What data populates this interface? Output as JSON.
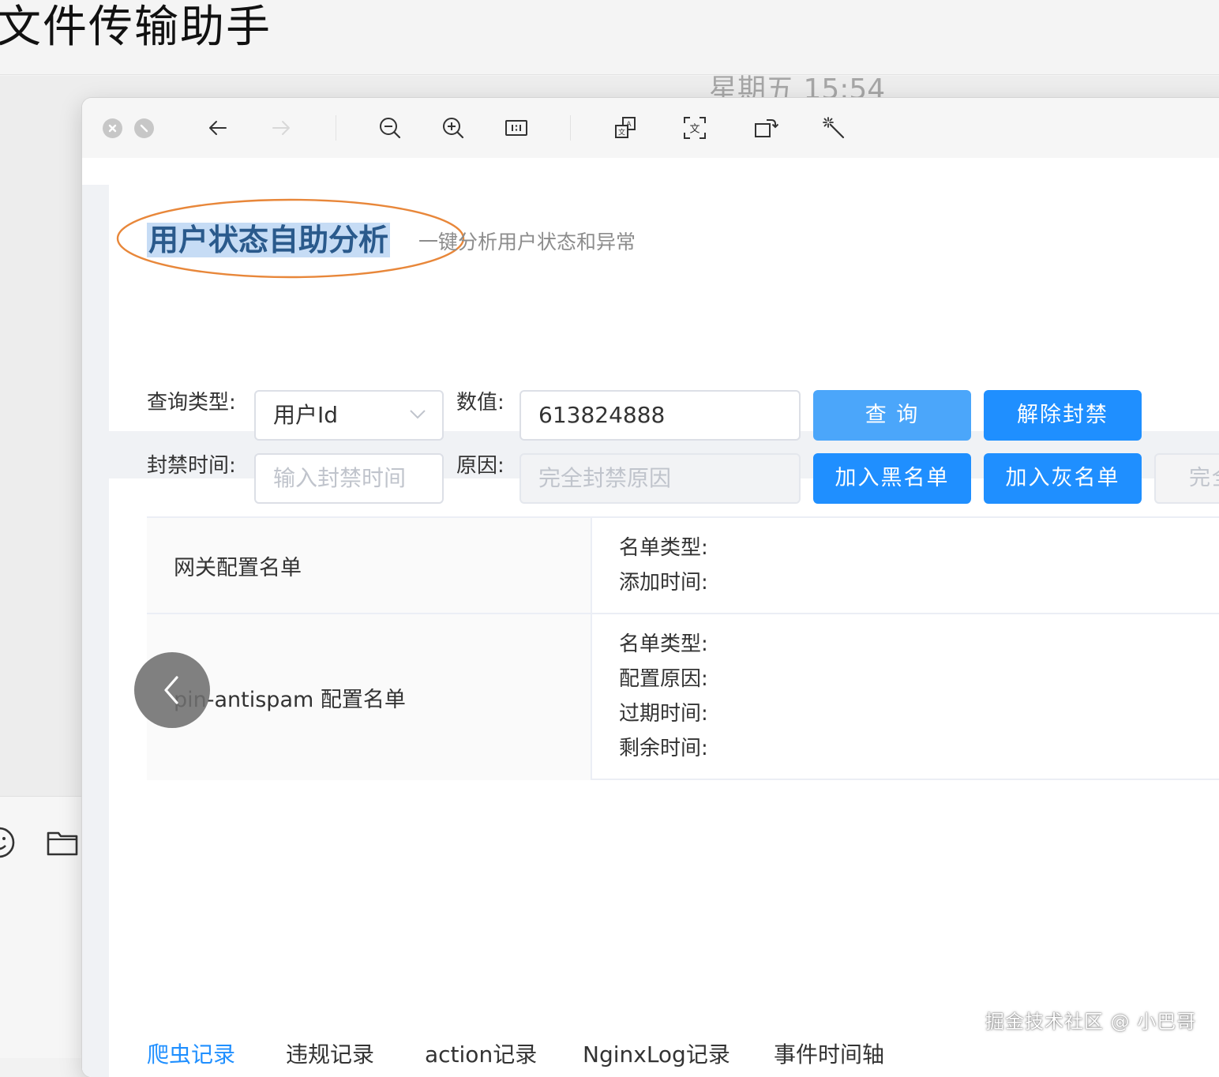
{
  "chat": {
    "title": "文件传输助手",
    "timestamp": "星期五 15:54"
  },
  "page": {
    "title": "用户状态自助分析",
    "subtitle": "一键分析用户状态和异常"
  },
  "form": {
    "query_type_label": "查询类型:",
    "query_type_value": "用户Id",
    "value_label": "数值:",
    "value": "613824888",
    "ban_time_label": "封禁时间:",
    "ban_time_placeholder": "输入封禁时间",
    "reason_label": "原因:",
    "reason_placeholder": "完全封禁原因"
  },
  "buttons": {
    "query": "查 询",
    "unban": "解除封禁",
    "add_blacklist": "加入黑名单",
    "add_graylist": "加入灰名单",
    "partial": "完全"
  },
  "descriptions": [
    {
      "label": "网关配置名单",
      "fields": [
        "名单类型:",
        "添加时间:"
      ]
    },
    {
      "label": "pin-antispam 配置名单",
      "fields": [
        "名单类型:",
        "配置原因:",
        "过期时间:",
        "剩余时间:"
      ]
    }
  ],
  "tabs": [
    {
      "label": "爬虫记录",
      "active": true
    },
    {
      "label": "违规记录",
      "active": false
    },
    {
      "label": "action记录",
      "active": false
    },
    {
      "label": "NginxLog记录",
      "active": false
    },
    {
      "label": "事件时间轴",
      "active": false
    }
  ],
  "watermark": "掘金技术社区 @ 小巴哥",
  "colors": {
    "primary": "#1f8fff",
    "title_highlight": "#c6dcf5",
    "annotation": "#e8873a"
  }
}
